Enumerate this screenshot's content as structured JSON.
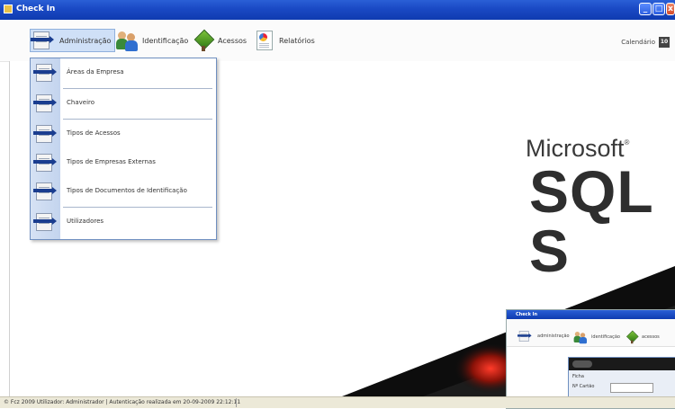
{
  "window": {
    "title": "Check In"
  },
  "toolbar": {
    "items": [
      {
        "label": "Administração",
        "icon": "admin-icon"
      },
      {
        "label": "Identificação",
        "icon": "people-icon"
      },
      {
        "label": "Acessos",
        "icon": "diamond-access-icon"
      },
      {
        "label": "Relatórios",
        "icon": "report-icon"
      }
    ],
    "calendar_label": "Calendário",
    "calendar_day": "10"
  },
  "menu": {
    "items": [
      {
        "label": "Áreas da Empresa"
      },
      {
        "label": "Chaveiro"
      },
      {
        "label": "Tipos de Acessos"
      },
      {
        "label": "Tipos de Empresas Externas"
      },
      {
        "label": "Tipos de Documentos de Identificação"
      },
      {
        "label": "Utilizadores"
      }
    ]
  },
  "background": {
    "brand": "Microsoft",
    "product": "SQL S"
  },
  "inset": {
    "title": "Check In",
    "toolbar": [
      "administração",
      "identificação",
      "acessos"
    ],
    "dialog_rows": [
      "Ficha",
      "Nº Cartão"
    ]
  },
  "status": {
    "text": "© Fcz 2009  Utilizador: Administrador | Autenticação realizada em 20-09-2009 22:12:11"
  },
  "colors": {
    "titlebar": "#1a49c4",
    "menu_gutter": "#c3d4ee",
    "active_tab": "#cfe0f7"
  }
}
